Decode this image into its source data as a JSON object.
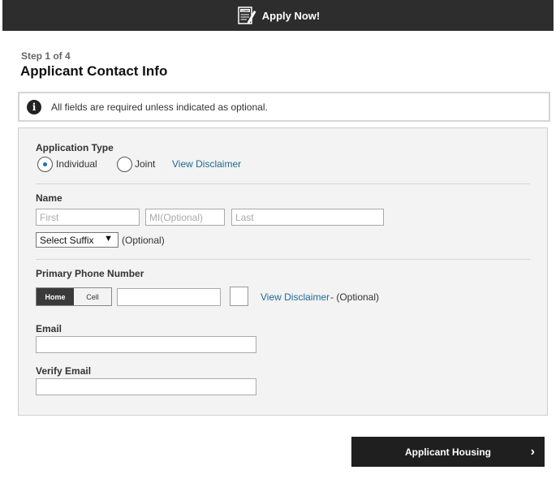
{
  "header": {
    "title": "Apply Now!",
    "icon": "document-pencil-icon",
    "doc_label": "LOAN"
  },
  "step": {
    "label": "Step 1 of 4"
  },
  "page_title": "Applicant Contact Info",
  "notice": {
    "icon": "info-icon",
    "glyph": "i",
    "text": "All fields are required unless indicated as optional."
  },
  "application_type": {
    "label": "Application Type",
    "options": [
      {
        "label": "Individual",
        "selected": true
      },
      {
        "label": "Joint",
        "selected": false
      }
    ],
    "disclaimer_link": "View Disclaimer"
  },
  "name": {
    "label": "Name",
    "first_placeholder": "First",
    "mi_placeholder": "MI(Optional)",
    "last_placeholder": "Last",
    "suffix_selected": "Select Suffix",
    "suffix_caret": "▼",
    "suffix_optional": "(Optional)"
  },
  "phone": {
    "label": "Primary Phone Number",
    "type_options": [
      {
        "label": "Home",
        "selected": true
      },
      {
        "label": "Cell",
        "selected": false
      }
    ],
    "disclaimer_link": "View Disclaimer",
    "optional_suffix": " - (Optional)"
  },
  "email": {
    "label": "Email",
    "value": ""
  },
  "verify_email": {
    "label": "Verify Email",
    "value": ""
  },
  "next_button": {
    "label": "Applicant Housing",
    "chevron": "›"
  },
  "colors": {
    "header_bg": "#2d2d2d",
    "link": "#1f6b93",
    "button_bg": "#1f1f1f",
    "panel_bg": "#f3f3f3"
  }
}
